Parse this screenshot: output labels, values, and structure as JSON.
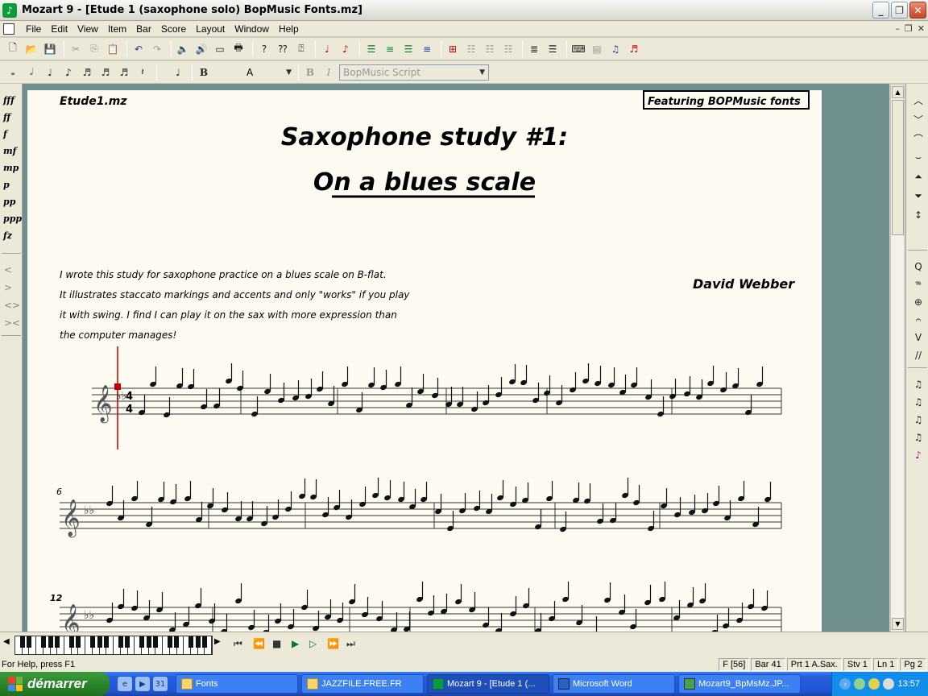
{
  "window": {
    "title": "Mozart 9 - [Etude 1 (saxophone solo) BopMusic Fonts.mz]"
  },
  "menu": [
    "File",
    "Edit",
    "View",
    "Item",
    "Bar",
    "Score",
    "Layout",
    "Window",
    "Help"
  ],
  "toolbar2": {
    "bold_label": "B",
    "font_letter": "A",
    "italic_bold": "B",
    "italic_i": "I",
    "font_name": "BopMusic Script"
  },
  "dynamics": [
    "fff",
    "ff",
    "f",
    "mf",
    "mp",
    "p",
    "pp",
    "ppp",
    "fz"
  ],
  "page": {
    "filename": "Etude1.mz",
    "featuring": "Featuring BOPMusic fonts",
    "title_line1": "Saxophone study #1:",
    "title_line2": "On a blues scale",
    "composer": "David Webber",
    "description_lines": [
      "I wrote this study for saxophone practice on a blues scale on B-flat.",
      "It illustrates staccato markings and accents and only \"works\" if you play",
      "it with swing.  I find I can play it on the sax with more expression than",
      "the computer manages!"
    ],
    "bar_numbers": [
      "6",
      "12"
    ]
  },
  "status": {
    "help": "For Help, press F1",
    "panes": [
      "F [56]",
      "Bar 41",
      "Prt 1 A.Sax.",
      "Stv 1",
      "Ln 1",
      "Pg 2"
    ]
  },
  "taskbar": {
    "start": "démarrer",
    "tasks": [
      "Fonts",
      "JAZZFILE.FREE.FR",
      "Mozart 9 - [Etude 1 (...",
      "Microsoft Word",
      "Mozart9_BpMsMz.JP..."
    ],
    "clock": "13:57"
  },
  "colors": {
    "page_bg": "#fdfbf1",
    "workspace": "#6f8f8f",
    "taskbar": "#245edb",
    "start": "#2e8a2e",
    "accent_red": "#c00000"
  }
}
